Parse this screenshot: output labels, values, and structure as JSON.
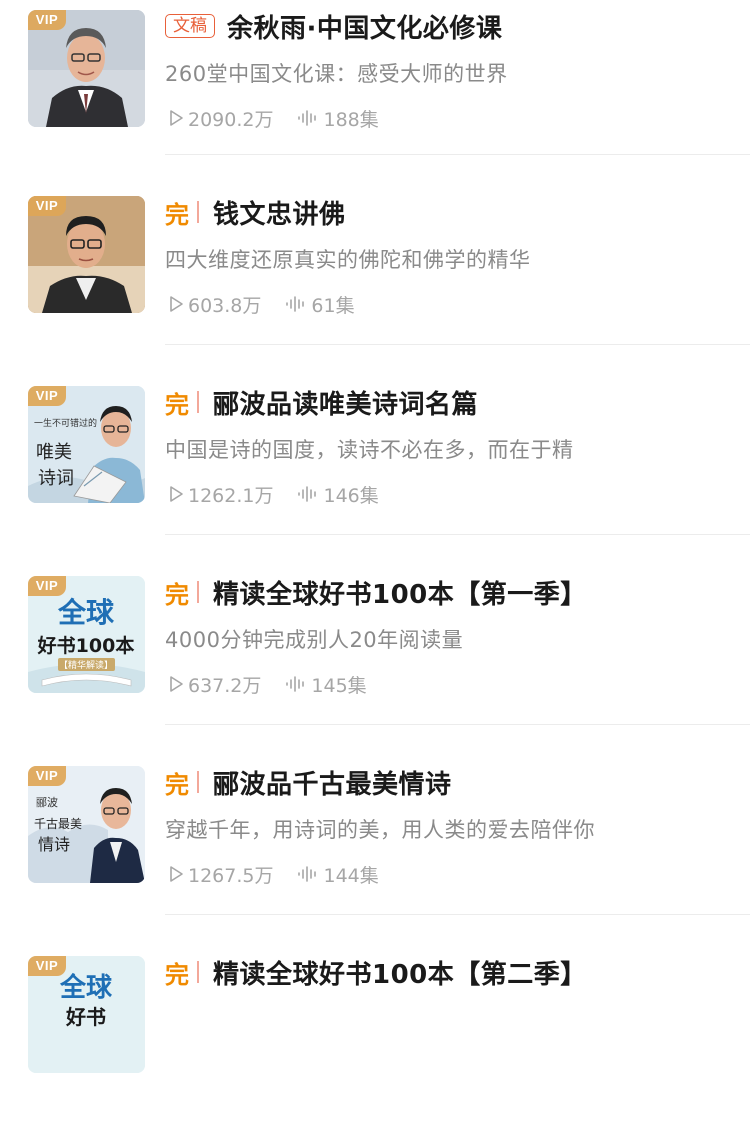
{
  "items": [
    {
      "badge_type": "wengao",
      "badge": "文稿",
      "title": "余秋雨·中国文化必修课",
      "subtitle": "260堂中国文化课：感受大师的世界",
      "plays": "2090.2万",
      "episodes": "188集",
      "vip": "VIP",
      "cover_bg": "#cfd6de"
    },
    {
      "badge_type": "wan",
      "badge": "完",
      "title": "钱文忠讲佛",
      "subtitle": "四大维度还原真实的佛陀和佛学的精华",
      "plays": "603.8万",
      "episodes": "61集",
      "vip": "VIP",
      "cover_bg": "#c9a57a"
    },
    {
      "badge_type": "wan",
      "badge": "完",
      "title": "郦波品读唯美诗词名篇",
      "subtitle": "中国是诗的国度，读诗不必在多，而在于精",
      "plays": "1262.1万",
      "episodes": "146集",
      "vip": "VIP",
      "cover_bg": "#d9e7ef",
      "cover_text": [
        "一生不可错过的",
        "唯美",
        "诗词"
      ]
    },
    {
      "badge_type": "wan",
      "badge": "完",
      "title": "精读全球好书100本【第一季】",
      "subtitle": "4000分钟完成别人20年阅读量",
      "plays": "637.2万",
      "episodes": "145集",
      "vip": "VIP",
      "cover_bg": "#dff0f3",
      "cover_text": [
        "全球",
        "好书100本",
        "【精华解读】"
      ]
    },
    {
      "badge_type": "wan",
      "badge": "完",
      "title": "郦波品千古最美情诗",
      "subtitle": "穿越千年，用诗词的美，用人类的爱去陪伴你",
      "plays": "1267.5万",
      "episodes": "144集",
      "vip": "VIP",
      "cover_bg": "#e6eef4",
      "cover_text": [
        "郦波",
        "千古最美",
        "情诗"
      ]
    },
    {
      "badge_type": "wan",
      "badge": "完",
      "title": "精读全球好书100本【第二季】",
      "subtitle": "",
      "plays": "",
      "episodes": "",
      "vip": "VIP",
      "cover_bg": "#dff0f3",
      "cover_text": [
        "全球",
        "好书"
      ]
    }
  ],
  "colors": {
    "accent_orange": "#f08a00",
    "tag_red": "#e8603a",
    "separator_pink": "#f3a89a",
    "vip_gold": "#dea656",
    "title": "#1a1a1a",
    "subtitle": "#8a8a8a",
    "meta": "#a6a6a6"
  },
  "icons": {
    "plays": "play-icon",
    "episodes": "audio-wave-icon"
  }
}
